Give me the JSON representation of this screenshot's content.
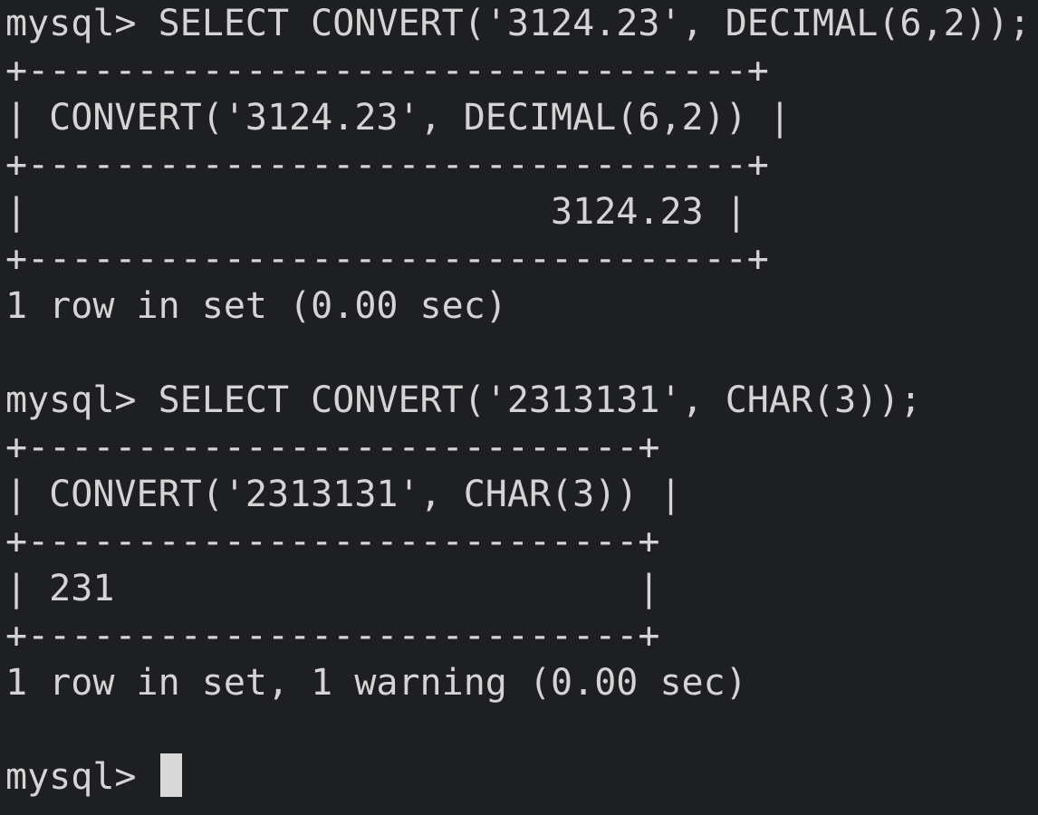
{
  "terminal": {
    "prompt": "mysql> ",
    "lines": [
      "mysql> SELECT CONVERT('3124.23', DECIMAL(6,2));",
      "+---------------------------------+",
      "| CONVERT('3124.23', DECIMAL(6,2)) |",
      "+---------------------------------+",
      "|                        3124.23 |",
      "+---------------------------------+",
      "1 row in set (0.00 sec)",
      "",
      "mysql> SELECT CONVERT('2313131', CHAR(3));",
      "+----------------------------+",
      "| CONVERT('2313131', CHAR(3)) |",
      "+----------------------------+",
      "| 231                        |",
      "+----------------------------+",
      "1 row in set, 1 warning (0.00 sec)",
      "",
      "mysql> "
    ],
    "colors": {
      "background": "#1e1f22",
      "text": "#d4d4d4",
      "cursor": "#d9d9d9"
    }
  }
}
